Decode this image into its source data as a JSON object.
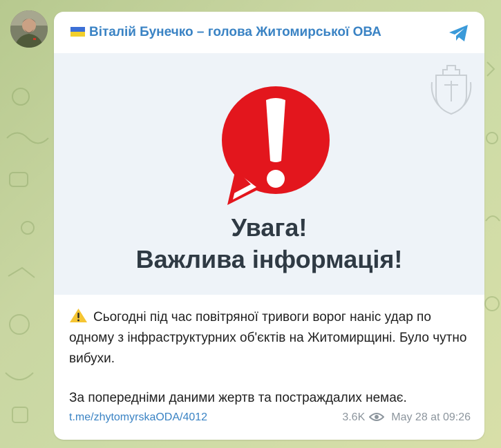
{
  "channel": {
    "title": "Віталій Бунечко – голова Житомирської ОВА",
    "flag_colors": [
      "#3c6fd6",
      "#f2cf2b"
    ],
    "avatar": "avatar-photo",
    "telegram_icon": "telegram-plane-icon"
  },
  "media": {
    "headline_line1": "Увага!",
    "headline_line2": "Важлива інформація!",
    "alert_color": "#e3161d",
    "alert_icon": "exclamation-bubble-icon",
    "emblem": "coat-of-arms-icon"
  },
  "message": {
    "paragraph1": "Сьогодні під час повітряної тривоги ворог наніс удар по одному з інфраструктурних об'єктів на Житомирщині. Було чутно вибухи.",
    "paragraph2": "За попередніми даними жертв та постраждалих немає.",
    "warning_icon": "warning-icon"
  },
  "footer": {
    "link": "t.me/zhytomyrskaODA/4012",
    "views": "3.6K",
    "views_icon": "eye-icon",
    "timestamp": "May 28 at 09:26"
  }
}
